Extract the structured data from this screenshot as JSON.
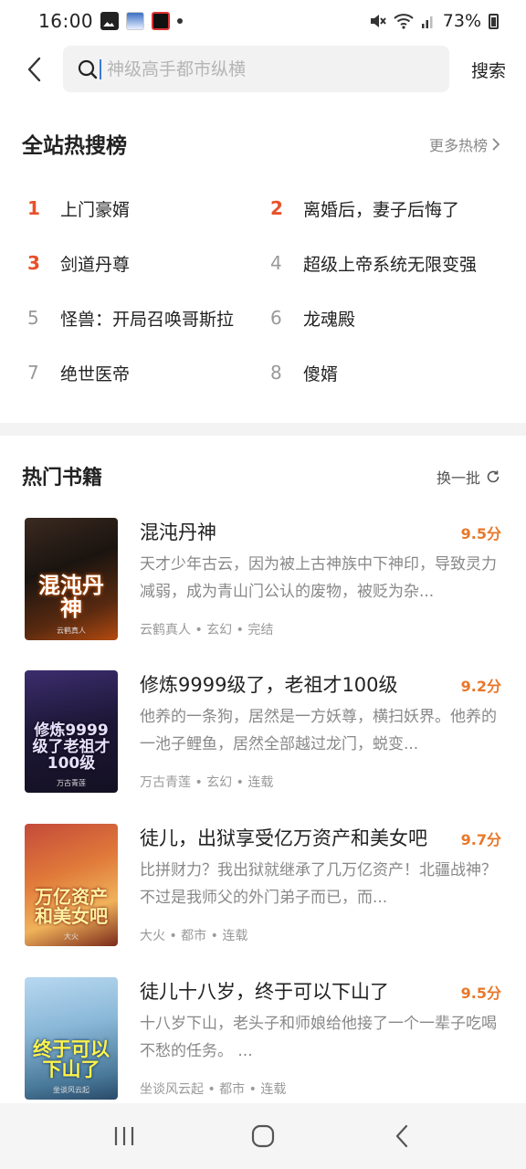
{
  "status_bar": {
    "time": "16:00",
    "battery": "73%",
    "icons": [
      "gallery-icon",
      "app-notification-icon",
      "video-app-icon",
      "dot-icon",
      "mute-icon",
      "wifi-icon",
      "signal-icon",
      "battery-icon"
    ]
  },
  "search": {
    "placeholder": "神级高手都市纵横",
    "button_label": "搜索"
  },
  "hot_search": {
    "title": "全站热搜榜",
    "more_label": "更多热榜",
    "items": [
      {
        "rank": "1",
        "text": "上门豪婿",
        "highlight": true
      },
      {
        "rank": "2",
        "text": "离婚后，妻子后悔了",
        "highlight": true
      },
      {
        "rank": "3",
        "text": "剑道丹尊",
        "highlight": true
      },
      {
        "rank": "4",
        "text": "超级上帝系统无限变强",
        "highlight": false
      },
      {
        "rank": "5",
        "text": "怪兽：开局召唤哥斯拉",
        "highlight": false
      },
      {
        "rank": "6",
        "text": "龙魂殿",
        "highlight": false
      },
      {
        "rank": "7",
        "text": "绝世医帝",
        "highlight": false
      },
      {
        "rank": "8",
        "text": "傻婿",
        "highlight": false
      }
    ]
  },
  "popular_books": {
    "title": "热门书籍",
    "refresh_label": "换一批",
    "books": [
      {
        "title": "混沌丹神",
        "score": "9.5分",
        "desc": "天才少年古云，因为被上古神族中下神印，导致灵力减弱，成为青山门公认的废物，被贬为杂...",
        "meta": "云鹤真人 • 玄幻 • 完结",
        "cover_text": "混沌丹神",
        "cover_author": "云鹤真人"
      },
      {
        "title": "修炼9999级了，老祖才100级",
        "score": "9.2分",
        "desc": "他养的一条狗，居然是一方妖尊，横扫妖界。他养的一池子鲤鱼，居然全部越过龙门，蜕变...",
        "meta": "万古青莲 • 玄幻 • 连载",
        "cover_text": "修炼9999级了老祖才100级",
        "cover_author": "万古青莲"
      },
      {
        "title": "徒儿，出狱享受亿万资产和美女吧",
        "score": "9.7分",
        "desc": "比拼财力？我出狱就继承了几万亿资产！北疆战神？不过是我师父的外门弟子而已，而...",
        "meta": "大火 • 都市 • 连载",
        "cover_text": "万亿资产和美女吧",
        "cover_author": "大火"
      },
      {
        "title": "徒儿十八岁，终于可以下山了",
        "score": "9.5分",
        "desc": "十八岁下山，老头子和师娘给他接了一个一辈子吃喝不愁的任务。 ...",
        "meta": "坐谈风云起 • 都市 • 连载",
        "cover_text": "终于可以下山了",
        "cover_author": "坐谈风云起"
      }
    ]
  },
  "colors": {
    "accent_rank": "#e8512a",
    "score": "#e8782a"
  }
}
